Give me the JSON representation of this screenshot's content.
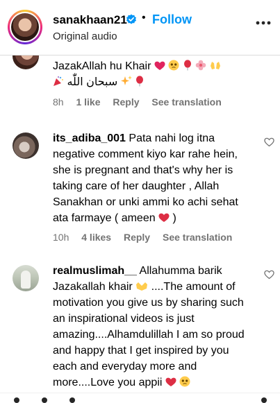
{
  "header": {
    "username": "sanakhaan21",
    "dot": "•",
    "follow_label": "Follow",
    "audio_label": "Original audio"
  },
  "comments": [
    {
      "username": "",
      "text": "JazakAllah hu Khair",
      "text_line2": "سبحان اللّٰه",
      "time": "8h",
      "likes": "1 like",
      "reply_label": "Reply",
      "translation_label": "See translation"
    },
    {
      "username": "its_adiba_001",
      "text": "Pata nahi log itna negative comment kiyo kar rahe hein, she is pregnant and that's why her is taking care of her daughter , Allah Sanakhan or unki ammi ko achi sehat ata farmaye ( ameen",
      "text_end": ")",
      "time": "10h",
      "likes": "4 likes",
      "reply_label": "Reply",
      "translation_label": "See translation"
    },
    {
      "username": "realmuslimah__",
      "text_line1": "Allahumma barik",
      "text_line2a": "Jazakallah khair",
      "text_rest": "....The amount of motivation you give us by sharing such an inspirational videos is just amazing....Alhamdulillah I am so proud and happy that I get inspired by you each and everyday more and more....Love you appii"
    }
  ],
  "icons": [
    "verified-badge-icon",
    "more-options-icon",
    "heart-outline-icon"
  ],
  "colors": {
    "follow_blue": "#0095f6",
    "verified_blue": "#0095f6",
    "meta_gray": "#737373"
  }
}
